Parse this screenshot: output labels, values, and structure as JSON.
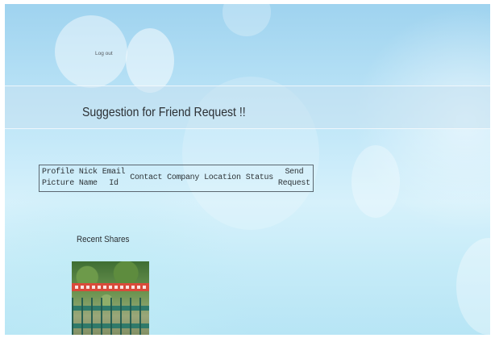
{
  "nav": {
    "logout_label": "Log out"
  },
  "section": {
    "title": "Suggestion for Friend Request !!"
  },
  "table": {
    "headers": [
      {
        "line1": "Profile",
        "line2": "Picture"
      },
      {
        "line1": "Nick",
        "line2": "Name"
      },
      {
        "line1": "Email",
        "line2": "Id"
      },
      {
        "line1": "Contact",
        "line2": ""
      },
      {
        "line1": "Company",
        "line2": ""
      },
      {
        "line1": "Location",
        "line2": ""
      },
      {
        "line1": "Status",
        "line2": ""
      },
      {
        "line1": "Send",
        "line2": "Request"
      }
    ]
  },
  "recent": {
    "title": "Recent Shares"
  }
}
